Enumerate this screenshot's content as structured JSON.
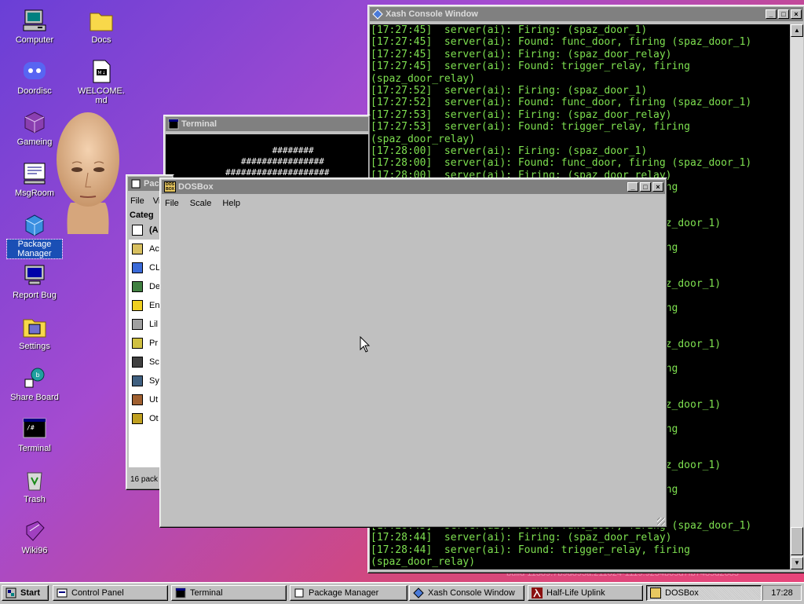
{
  "desktop": {
    "icons": [
      {
        "label": "Computer"
      },
      {
        "label": "Docs"
      },
      {
        "label": "Doordisc"
      },
      {
        "label": "WELCOME.md"
      },
      {
        "label": "Gameing"
      },
      {
        "label": "MsgRoom"
      },
      {
        "label": "Package Manager"
      },
      {
        "label": "Report Bug"
      },
      {
        "label": "Settings"
      },
      {
        "label": "Share Board"
      },
      {
        "label": "Terminal"
      },
      {
        "label": "Trash"
      },
      {
        "label": "Wiki96"
      }
    ],
    "build_string": "build 11389.7b9d893a.211024-1119.9234b05d7fb7485d2683"
  },
  "xash": {
    "title": "Xash Console Window",
    "lines": [
      "[17:27:45]  server(ai): Firing: (spaz_door_1)",
      "[17:27:45]  server(ai): Found: func_door, firing (spaz_door_1)",
      "[17:27:45]  server(ai): Firing: (spaz_door_relay)",
      "[17:27:45]  server(ai): Found: trigger_relay, firing",
      "(spaz_door_relay)",
      "[17:27:52]  server(ai): Firing: (spaz_door_1)",
      "[17:27:52]  server(ai): Found: func_door, firing (spaz_door_1)",
      "[17:27:53]  server(ai): Firing: (spaz_door_relay)",
      "[17:27:53]  server(ai): Found: trigger_relay, firing",
      "(spaz_door_relay)",
      "[17:28:00]  server(ai): Firing: (spaz_door_1)",
      "[17:28:00]  server(ai): Found: func_door, firing (spaz_door_1)",
      "[17:28:00]  server(ai): Firing: (spaz_door_relay)",
      "                                            firing",
      "",
      "",
      "                                            (spaz_door_1)",
      "",
      "                                            firing",
      "",
      "",
      "                                            (spaz_door_1)",
      "",
      "                                            firing",
      "",
      "",
      "                                            (spaz_door_1)",
      "",
      "                                            firing",
      "",
      "",
      "                                            (spaz_door_1)",
      "",
      "                                            firing",
      "",
      "",
      "                                            (spaz_door_1)",
      "",
      "                                            firing",
      "",
      "",
      "[17:28:43]  server(ai): Found: func_door, firing (spaz_door_1)",
      "[17:28:44]  server(ai): Firing: (spaz_door_relay)",
      "[17:28:44]  server(ai): Found: trigger_relay, firing",
      "(spaz_door_relay)"
    ]
  },
  "terminal": {
    "title": "Terminal",
    "lines": [
      "          ########",
      "      ################",
      "    ####################"
    ]
  },
  "pkgmgr": {
    "title": "Package Manager",
    "title_visible": "Pac",
    "menu": [
      "File",
      "Vi"
    ],
    "category_header": "Categ",
    "categories": [
      "(A",
      "Ac",
      "CL",
      "De",
      "En",
      "Lil",
      "Pr",
      "Sc",
      "Sy",
      "Ut",
      "Ot"
    ],
    "status": "16 pack"
  },
  "dosbox": {
    "title": "DOSBox",
    "icon_text": "DOS BOX",
    "menu": [
      "File",
      "Scale",
      "Help"
    ]
  },
  "taskbar": {
    "start": "Start",
    "items": [
      "Control Panel",
      "Terminal",
      "Package Manager",
      "Xash Console Window",
      "Half-Life Uplink",
      "DOSBox"
    ],
    "clock": "17:28"
  },
  "colors": {
    "console_text": "#7ee050",
    "title_active": "#000080",
    "face": "#c0c0c0"
  }
}
